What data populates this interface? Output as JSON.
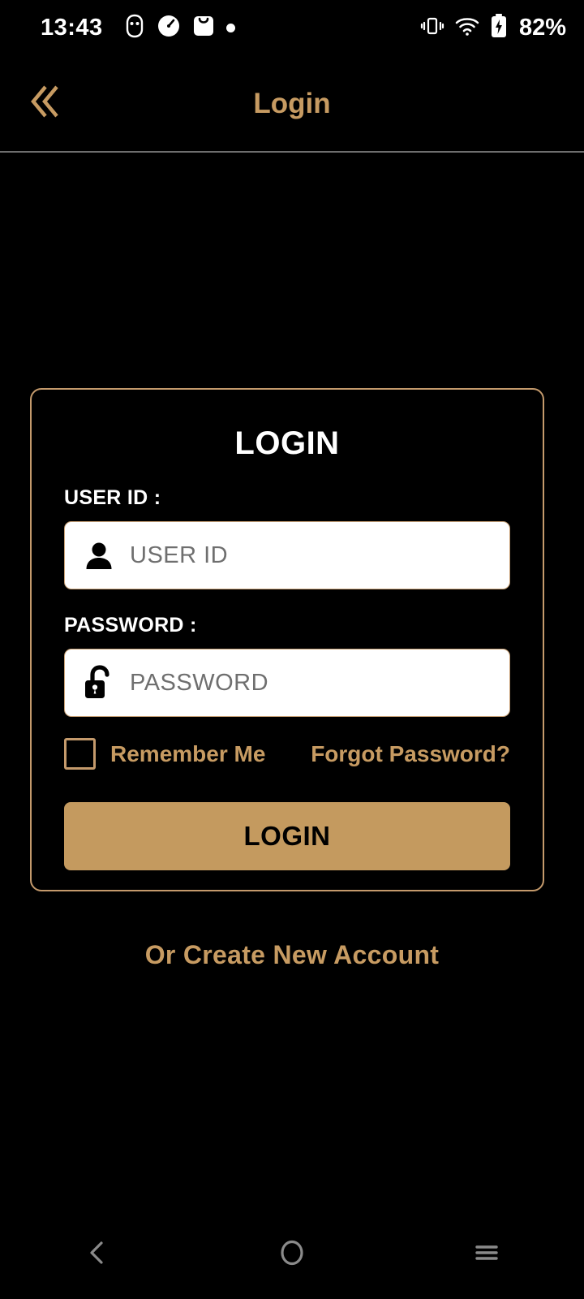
{
  "status_bar": {
    "time": "13:43",
    "battery_percent": "82%",
    "left_icons": [
      "app-notification-icon",
      "speedometer-icon",
      "shopping-bag-icon",
      "dot-indicator-icon"
    ],
    "right_icons": [
      "vibrate-icon",
      "wifi-icon",
      "battery-charging-icon"
    ]
  },
  "header": {
    "title": "Login",
    "back_icon": "double-chevron-left-icon",
    "title_color": "#c79b62"
  },
  "login_card": {
    "title": "LOGIN",
    "user_id": {
      "label": "USER ID :",
      "placeholder": "USER ID",
      "value": "",
      "icon": "person-icon"
    },
    "password": {
      "label": "PASSWORD :",
      "placeholder": "PASSWORD",
      "value": "",
      "icon": "unlock-padlock-icon"
    },
    "remember_me": {
      "label": "Remember Me",
      "checked": false
    },
    "forgot_password": "Forgot Password?",
    "submit_label": "LOGIN",
    "border_color": "#c49a6c",
    "button_color": "#c49a5f"
  },
  "create_account": "Or Create New Account",
  "nav_bar": {
    "back_icon": "chevron-left-icon",
    "home_icon": "circle-home-icon",
    "recents_icon": "hamburger-recents-icon"
  }
}
